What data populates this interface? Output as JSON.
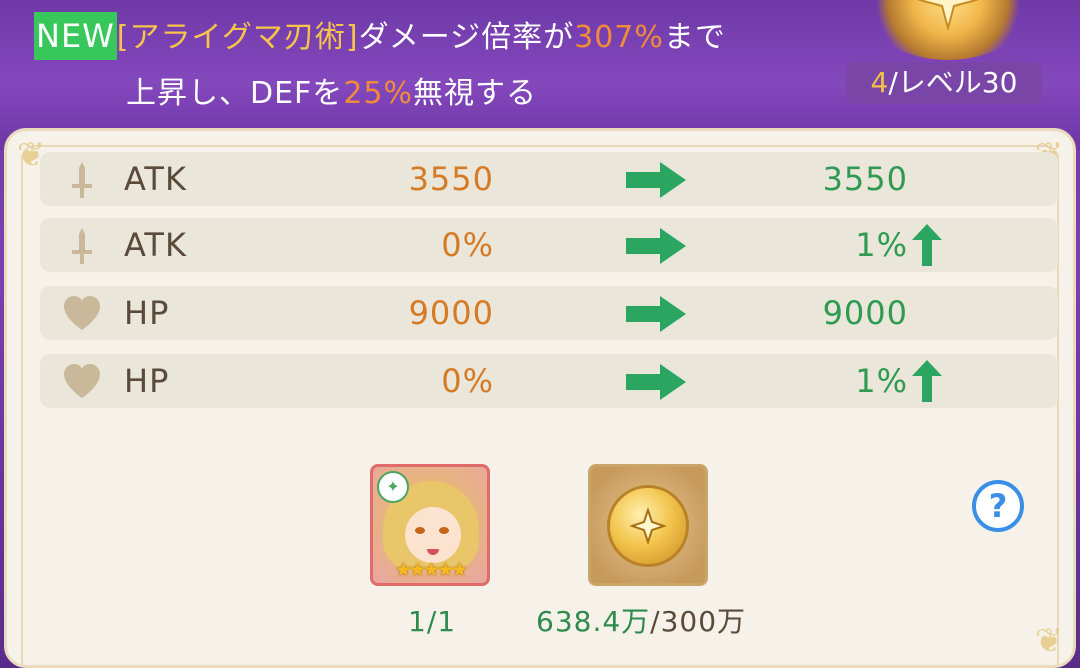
{
  "skill": {
    "new_badge": "NEW",
    "name": "[アライグマ刃術]",
    "text_a": "ダメージ倍率が",
    "rate": "307%",
    "text_b": "まで",
    "text_c": "上昇し、DEFを",
    "ignore": "25%",
    "text_d": "無視する"
  },
  "level": {
    "num": "4",
    "label": "/レベル30"
  },
  "stats": [
    {
      "icon": "sword-icon",
      "name": "ATK",
      "old": "3550",
      "new": "3550",
      "up": false
    },
    {
      "icon": "sword-icon",
      "name": "ATK",
      "old": "0%",
      "new": "1%",
      "up": true
    },
    {
      "icon": "heart-icon",
      "name": "HP",
      "old": "9000",
      "new": "9000",
      "up": false
    },
    {
      "icon": "heart-icon",
      "name": "HP",
      "old": "0%",
      "new": "1%",
      "up": true
    }
  ],
  "materials": {
    "hero": {
      "stars": "★★★★★",
      "count": "1/1",
      "rarity_stars": 5
    },
    "coin": {
      "owned": "638.4万",
      "sep": "/",
      "required": "300万"
    }
  },
  "help": {
    "label": "?"
  },
  "colors": {
    "accent_orange": "#ef8b3a",
    "stat_green": "#2e9a52",
    "panel": "#f6f2e9"
  }
}
